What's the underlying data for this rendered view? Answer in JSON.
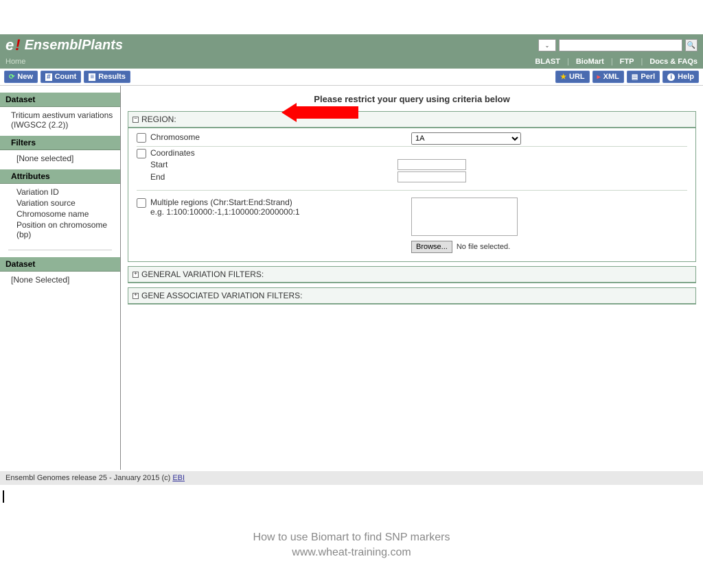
{
  "header": {
    "logo": "EnsemblPlants",
    "home_label": "Home",
    "nav_links": {
      "blast": "BLAST",
      "biomart": "BioMart",
      "ftp": "FTP",
      "docs": "Docs & FAQs"
    }
  },
  "toolbar": {
    "new_label": "New",
    "count_label": "Count",
    "results_label": "Results",
    "url_label": "URL",
    "xml_label": "XML",
    "perl_label": "Perl",
    "help_label": "Help"
  },
  "sidebar": {
    "dataset_header": "Dataset",
    "dataset_text": "Triticum aestivum variations (IWGSC2 (2.2))",
    "filters_header": "Filters",
    "filters_text": "[None selected]",
    "attributes_header": "Attributes",
    "attributes": [
      "Variation ID",
      "Variation source",
      "Chromosome name",
      "Position on chromosome (bp)"
    ],
    "dataset2_header": "Dataset",
    "dataset2_text": "[None Selected]"
  },
  "main": {
    "title": "Please restrict your query using criteria below",
    "region": {
      "header": "REGION:",
      "chromosome_label": "Chromosome",
      "chromosome_value": "1A",
      "coordinates_label": "Coordinates",
      "start_label": "Start",
      "end_label": "End",
      "multi_label": "Multiple regions (Chr:Start:End:Strand)",
      "multi_example": "e.g. 1:100:10000:-1,1:100000:2000000:1",
      "browse_label": "Browse...",
      "no_file": "No file selected."
    },
    "general_filters_header": "GENERAL VARIATION FILTERS:",
    "gene_filters_header": "GENE ASSOCIATED VARIATION FILTERS:"
  },
  "footer": {
    "text_prefix": "Ensembl Genomes release 25 - January 2015 (c) ",
    "link": "EBI"
  },
  "caption": {
    "line1": "How to use Biomart to find SNP markers",
    "line2": "www.wheat-training.com"
  }
}
